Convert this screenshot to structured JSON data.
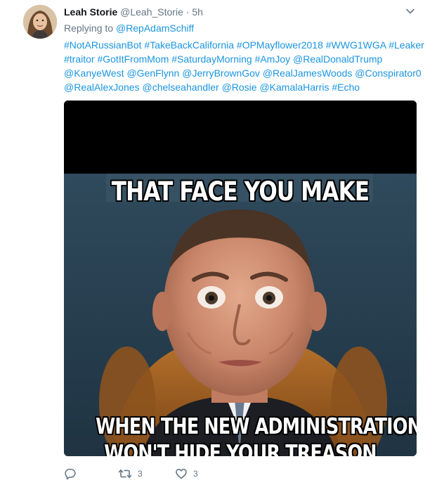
{
  "tweet": {
    "display_name": "Leah Storie",
    "handle": "@Leah_Storie",
    "separator": "·",
    "time": "5h",
    "replying_prefix": "Replying to",
    "replying_to": "@RepAdamSchiff",
    "text_lines": [
      [
        "#NotARussianBot",
        "#TakeBackCalifornia",
        "#OPMayflower2018",
        "#WWG1WGA",
        "#Leaker"
      ],
      [
        "#traitor",
        "#GotItFromMom",
        "#SaturdayMorning",
        "#AmJoy",
        "@RealDonaldTrump"
      ],
      [
        "@KanyeWest",
        "@GenFlynn",
        "@JerryBrownGov",
        "@RealJamesWoods",
        "@Conspirator0"
      ],
      [
        "@RealAlexJones",
        "@chelseahandler",
        "@Rosie",
        "@KamalaHarris",
        "#Echo"
      ]
    ],
    "media": {
      "caption_top": "THAT FACE YOU MAKE",
      "caption_bottom": "WHEN THE NEW ADMINISTRATION",
      "caption_cut": "WON'T HIDE YOUR TREASON"
    },
    "actions": {
      "reply_count": "",
      "retweet_count": "3",
      "like_count": "3"
    }
  },
  "colors": {
    "link": "#1b95e0",
    "muted": "#657786",
    "text": "#14171a"
  },
  "icons": {
    "caret": "chevron-down-icon",
    "reply": "reply-icon",
    "retweet": "retweet-icon",
    "like": "heart-icon"
  }
}
